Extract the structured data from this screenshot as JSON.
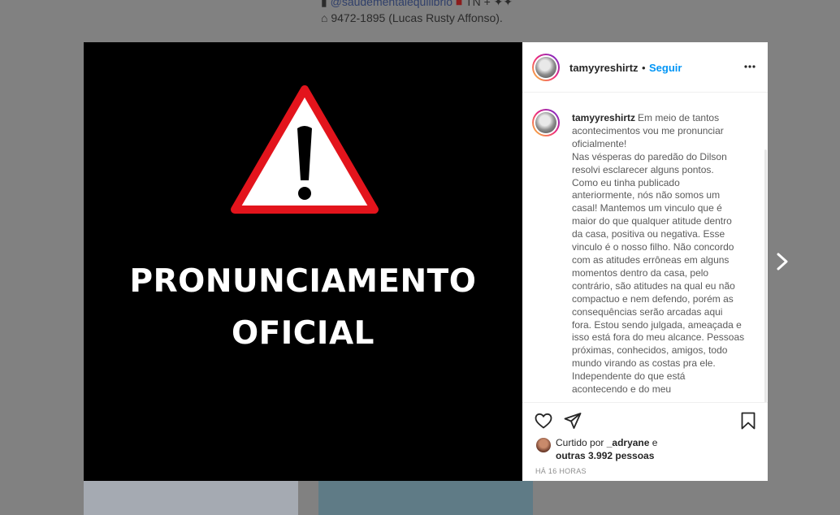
{
  "background": {
    "line1_link": "@saudementalequilibrio",
    "line1_rest": "TN +",
    "line2": "9472-1895 (Lucas Rusty Affonso)."
  },
  "post_image": {
    "headline_line1": "PRONUNCIAMENTO",
    "headline_line2": "OFICIAL",
    "warning_colors": {
      "border": "#e3141c",
      "fill": "#ffffff",
      "mark": "#000000"
    }
  },
  "post": {
    "username": "tamyyreshirtz",
    "separator": "•",
    "follow_label": "Seguir",
    "more_icon": "more-options-icon",
    "caption_lines": [
      "Em meio de tantos",
      "acontecimentos vou me pronunciar",
      "oficialmente!",
      "Nas vésperas do paredão do Dilson",
      "resolvi esclarecer alguns pontos.",
      "Como eu tinha publicado",
      "anteriormente, nós não somos um",
      "casal! Mantemos um vinculo que é",
      "maior do que qualquer atitude dentro",
      "da casa, positiva ou negativa. Esse",
      "vinculo é o nosso filho. Não concordo",
      "com as atitudes errôneas em alguns",
      "momentos dentro da casa, pelo",
      "contrário, são atitudes na qual eu não",
      "compactuo e nem defendo, porém as",
      "consequências serão arcadas aqui",
      "fora. Estou sendo julgada, ameaçada e",
      "isso está fora do meu alcance. Pessoas",
      "próximas, conhecidos, amigos, todo",
      "mundo virando as costas pra ele.",
      "Independente do que está",
      "acontecendo e do meu"
    ],
    "likes_prefix": "Curtido por",
    "likes_user": "_adryane",
    "likes_mid": "e",
    "likes_others": "outras 3.992 pessoas",
    "timestamp": "HÁ 16 HORAS"
  },
  "colors": {
    "accent": "#0095f6",
    "overlay": "#818181"
  }
}
